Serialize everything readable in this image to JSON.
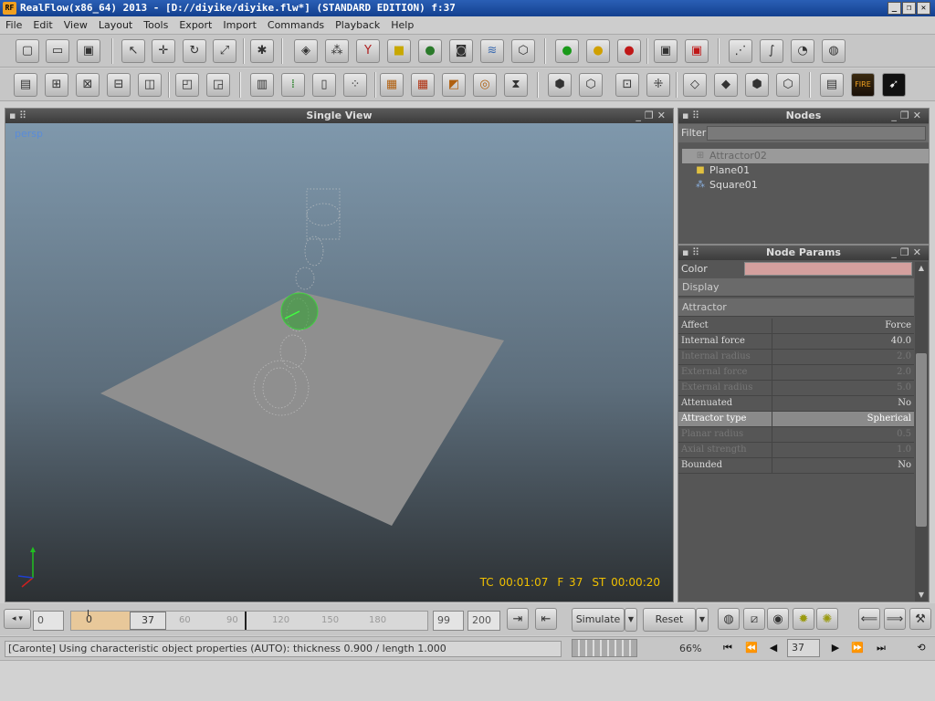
{
  "window": {
    "title": "RealFlow(x86_64) 2013 - [D://diyike/diyike.flw*] (STANDARD EDITION) f:37",
    "logo_text": "RF",
    "min_label": "_",
    "max_label": "❐",
    "close_label": "✕"
  },
  "menu": [
    "File",
    "Edit",
    "View",
    "Layout",
    "Tools",
    "Export",
    "Import",
    "Commands",
    "Playback",
    "Help"
  ],
  "viewport": {
    "title": "Single View",
    "camera": "persp",
    "timecode": "TC 00:01:07",
    "frame": "F 37",
    "simtime": "ST 00:00:20"
  },
  "nodes": {
    "title": "Nodes",
    "filter_label": "Filter",
    "items": [
      "Attractor02",
      "Plane01",
      "Square01"
    ]
  },
  "params": {
    "title": "Node Params",
    "color_label": "Color",
    "color_value": "#d4a09e",
    "display_label": "Display",
    "attractor_label": "Attractor",
    "rows": [
      {
        "key": "Affect",
        "value": "Force"
      },
      {
        "key": "Internal force",
        "value": "40.0"
      },
      {
        "key": "Internal radius",
        "value": "2.0"
      },
      {
        "key": "External force",
        "value": "2.0"
      },
      {
        "key": "External radius",
        "value": "5.0"
      },
      {
        "key": "Attenuated",
        "value": "No"
      },
      {
        "key": "Attractor type",
        "value": "Spherical"
      },
      {
        "key": "Planar radius",
        "value": "0.5"
      },
      {
        "key": "Axial strength",
        "value": "1.0"
      },
      {
        "key": "Bounded",
        "value": "No"
      }
    ]
  },
  "timeline": {
    "start": "0",
    "range_start": "0",
    "current": "37",
    "ticks": [
      "60",
      "90",
      "120",
      "150",
      "180"
    ],
    "end_min": "99",
    "end_max": "200",
    "simulate_label": "Simulate",
    "reset_label": "Reset"
  },
  "status": {
    "message": "[Caronte] Using characteristic object properties (AUTO): thickness 0.900 / length 1.000",
    "progress": "66%",
    "frame": "37"
  }
}
